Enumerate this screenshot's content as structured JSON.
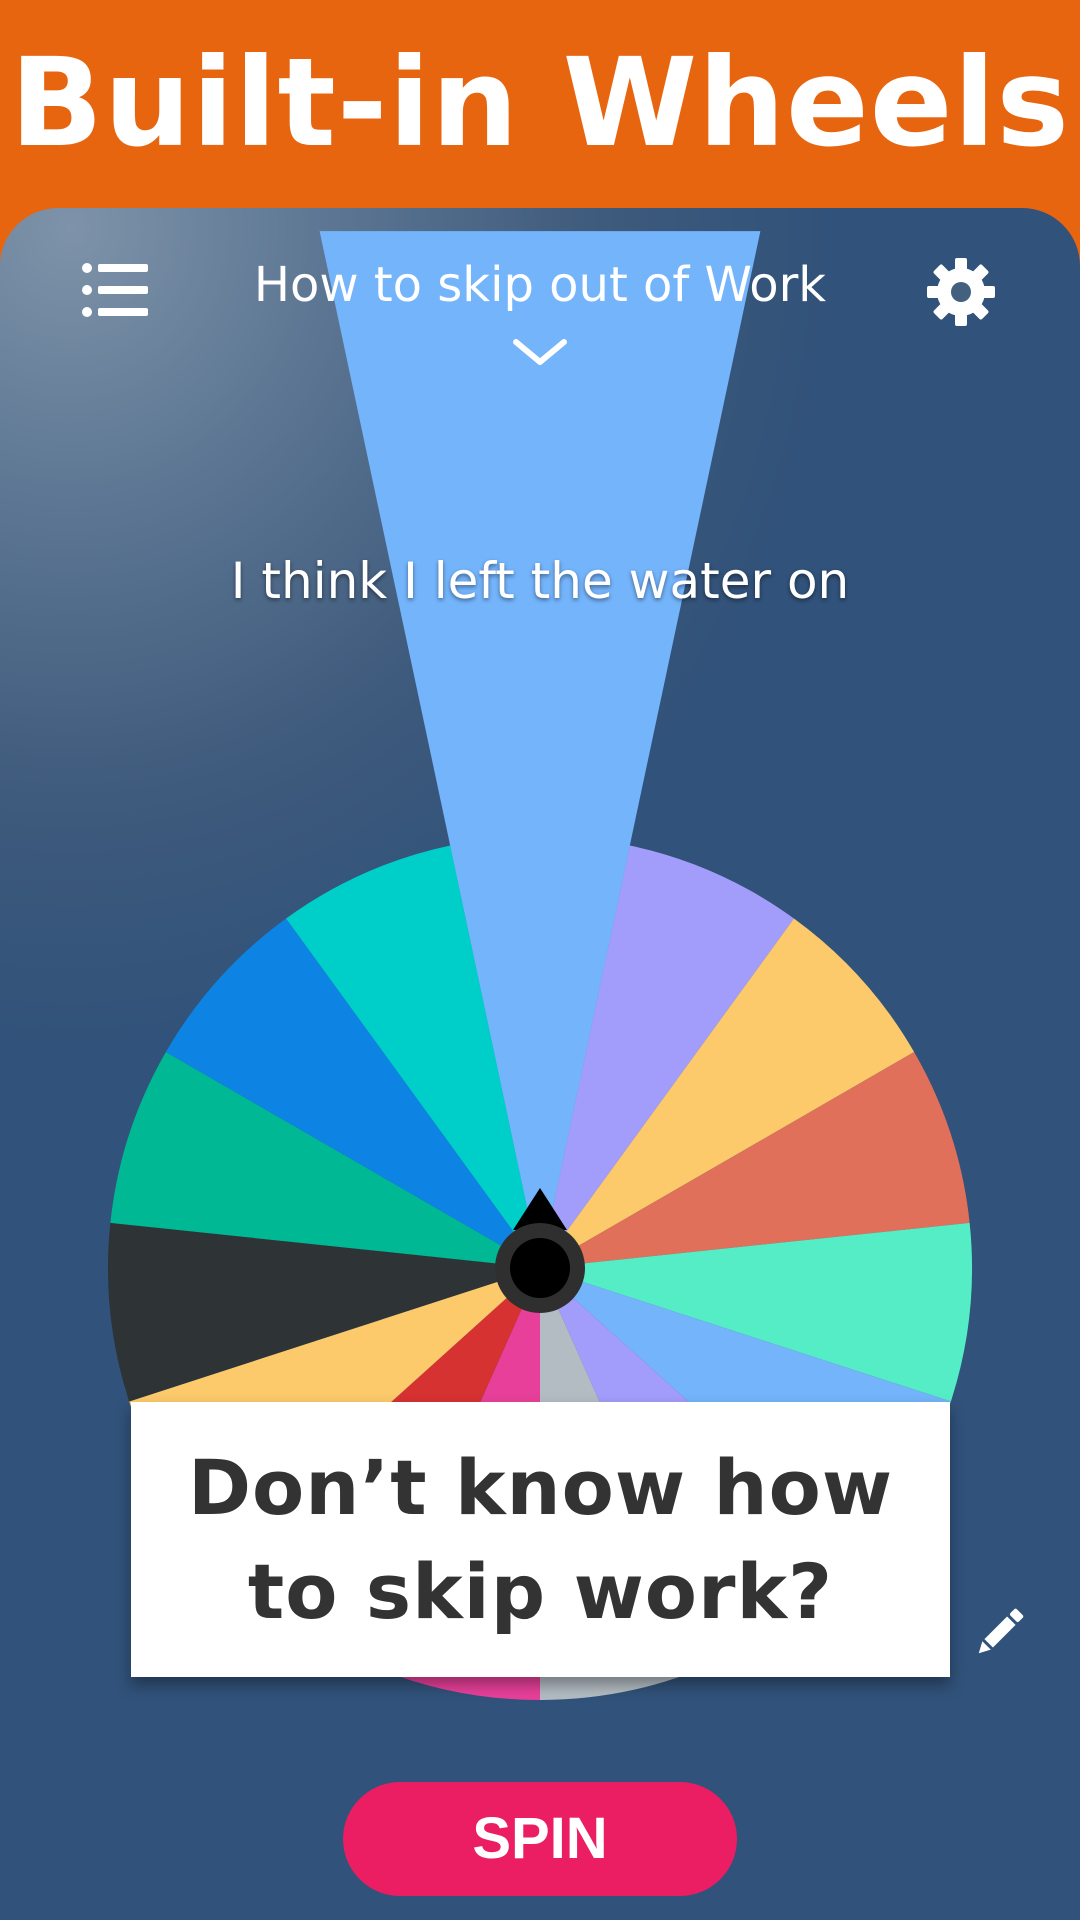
{
  "banner": {
    "title": "Built-in Wheels"
  },
  "header": {
    "wheel_title": "How to skip out of Work",
    "menu_icon": "list-menu-icon",
    "settings_icon": "gear-icon",
    "dropdown_icon": "chevron-down-icon"
  },
  "result": {
    "text": "I think I left the water on"
  },
  "wheel": {
    "segment_colors": [
      "#74b4fb",
      "#a29dfb",
      "#fcc96b",
      "#e1705a",
      "#55edc6",
      "#74b4fb",
      "#a29dfb",
      "#b3bcc3",
      "#e8409a",
      "#d63231",
      "#fcc96b",
      "#2e3436",
      "#00b894",
      "#0d84e3",
      "#00cec9"
    ],
    "highlight_color": "#74b4fb",
    "pointer_icon": "spinner-pointer-icon"
  },
  "caption": {
    "text": "Don’t know how to skip work?"
  },
  "edit_icon": "pencil-icon",
  "spin": {
    "label": "SPIN",
    "color": "#eb1e63"
  }
}
